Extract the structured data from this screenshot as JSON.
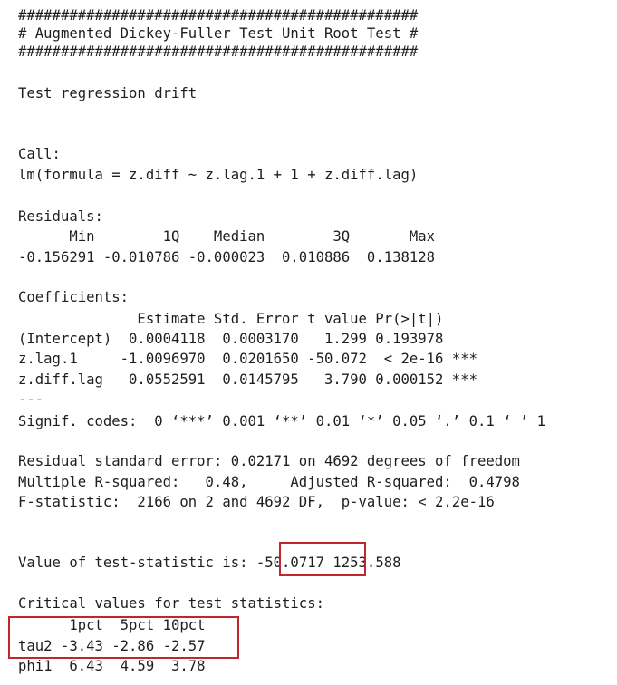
{
  "console": {
    "header_hash_top": "###############################################",
    "header_title": "# Augmented Dickey-Fuller Test Unit Root Test #",
    "header_hash_bottom": "###############################################",
    "test_regression": "Test regression drift",
    "call_label": "Call:",
    "call_formula": "lm(formula = z.diff ~ z.lag.1 + 1 + z.diff.lag)",
    "residuals_label": "Residuals:",
    "residuals_header": "      Min        1Q    Median        3Q       Max",
    "residuals_values": "-0.156291 -0.010786 -0.000023  0.010886  0.138128",
    "coefficients_label": "Coefficients:",
    "coef_header": "              Estimate Std. Error t value Pr(>|t|)",
    "coef_rows": [
      "(Intercept)  0.0004118  0.0003170   1.299 0.193978",
      "z.lag.1     -1.0096970  0.0201650 -50.072  < 2e-16 ***",
      "z.diff.lag   0.0552591  0.0145795   3.790 0.000152 ***"
    ],
    "separator": "---",
    "signif_codes": "Signif. codes:  0 ‘***’ 0.001 ‘**’ 0.01 ‘*’ 0.05 ‘.’ 0.1 ‘ ’ 1",
    "residual_std_error": "Residual standard error: 0.02171 on 4692 degrees of freedom",
    "r_squared": "Multiple R-squared:   0.48,     Adjusted R-squared:  0.4798",
    "f_statistic": "F-statistic:  2166 on 2 and 4692 DF,  p-value: < 2.2e-16",
    "test_statistic_prefix": "Value of test-statistic is: ",
    "test_statistic_value": "-50.0717",
    "test_statistic_rest": " 1253.588",
    "critical_values_label": "Critical values for test statistics:",
    "crit_header": "      1pct  5pct 10pct",
    "crit_tau2": "tau2 -3.43 -2.86 -2.57",
    "crit_phi1": "phi1  6.43  4.59  3.78"
  },
  "colors": {
    "text": "#1e1e1e",
    "highlight_box": "#c0272d",
    "background": "#ffffff"
  }
}
